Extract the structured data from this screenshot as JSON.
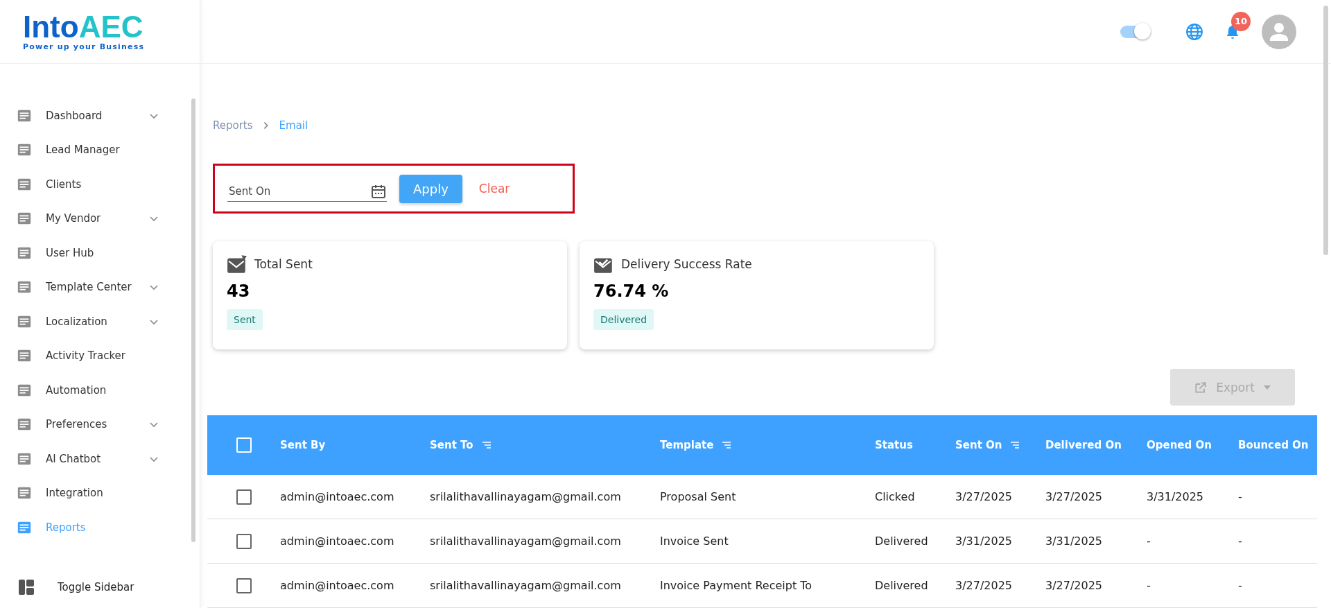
{
  "header": {
    "logo": {
      "word": "Into",
      "accent": "AEC",
      "tagline": "Power up your Business"
    },
    "theme_toggle": {
      "on": true
    },
    "notifications": {
      "badge": "10"
    }
  },
  "sidebar": {
    "items": [
      {
        "label": "Dashboard",
        "expandable": true,
        "selected": false
      },
      {
        "label": "Lead Manager",
        "expandable": false,
        "selected": false
      },
      {
        "label": "Clients",
        "expandable": false,
        "selected": false
      },
      {
        "label": "My Vendor",
        "expandable": true,
        "selected": false
      },
      {
        "label": "User Hub",
        "expandable": false,
        "selected": false
      },
      {
        "label": "Template Center",
        "expandable": true,
        "selected": false
      },
      {
        "label": "Localization",
        "expandable": true,
        "selected": false
      },
      {
        "label": "Activity Tracker",
        "expandable": false,
        "selected": false
      },
      {
        "label": "Automation",
        "expandable": false,
        "selected": false
      },
      {
        "label": "Preferences",
        "expandable": true,
        "selected": false
      },
      {
        "label": "AI Chatbot",
        "expandable": true,
        "selected": false
      },
      {
        "label": "Integration",
        "expandable": false,
        "selected": false
      },
      {
        "label": "Reports",
        "expandable": false,
        "selected": true
      }
    ],
    "toggle": "Toggle Sidebar"
  },
  "breadcrumb": [
    "Reports",
    "Email"
  ],
  "filter": {
    "highlighted": true,
    "field": {
      "placeholder": "Sent On"
    },
    "apply": "Apply",
    "clear": "Clear"
  },
  "cards": [
    {
      "title": "Total Sent",
      "value": "43",
      "tag": "Sent"
    },
    {
      "title": "Delivery Success Rate",
      "value": "76.74 %",
      "tag": "Delivered"
    }
  ],
  "export": {
    "label": "Export",
    "disabled": true
  },
  "table": {
    "select_all": {
      "checked": false
    },
    "columns": [
      {
        "label": "Sent By",
        "sortable": false
      },
      {
        "label": "Sent To",
        "sortable": true
      },
      {
        "label": "Template",
        "sortable": true
      },
      {
        "label": "Status",
        "sortable": false
      },
      {
        "label": "Sent On",
        "sortable": true
      },
      {
        "label": "Delivered On",
        "sortable": false
      },
      {
        "label": "Opened On",
        "sortable": false
      },
      {
        "label": "Bounced On",
        "sortable": false
      }
    ],
    "rows": [
      {
        "selected": false,
        "cells": [
          "admin@intoaec.com",
          "srilalithavallinayagam@gmail.com",
          "Proposal Sent",
          "Clicked",
          "3/27/2025",
          "3/27/2025",
          "3/31/2025",
          "-"
        ]
      },
      {
        "selected": false,
        "cells": [
          "admin@intoaec.com",
          "srilalithavallinayagam@gmail.com",
          "Invoice Sent",
          "Delivered",
          "3/31/2025",
          "3/31/2025",
          "-",
          "-"
        ]
      },
      {
        "selected": false,
        "cells": [
          "admin@intoaec.com",
          "srilalithavallinayagam@gmail.com",
          "Invoice Payment Receipt To",
          "Delivered",
          "3/27/2025",
          "3/27/2025",
          "-",
          "-"
        ]
      }
    ]
  }
}
